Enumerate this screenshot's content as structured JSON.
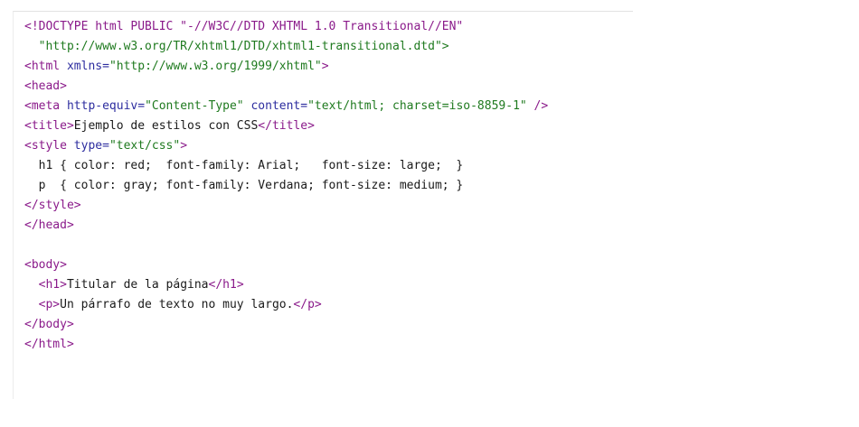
{
  "code_lines": [
    [
      {
        "t": "tag",
        "s": "<!DOCTYPE html PUBLIC \"-//W3C//DTD XHTML 1.0 Transitional//EN\""
      }
    ],
    [
      {
        "t": "val",
        "s": "  \"http://www.w3.org/TR/xhtml1/DTD/xhtml1-transitional.dtd\">"
      }
    ],
    [
      {
        "t": "tag",
        "s": "<html "
      },
      {
        "t": "attr",
        "s": "xmlns="
      },
      {
        "t": "val",
        "s": "\"http://www.w3.org/1999/xhtml\""
      },
      {
        "t": "tag",
        "s": ">"
      }
    ],
    [
      {
        "t": "tag",
        "s": "<head>"
      }
    ],
    [
      {
        "t": "tag",
        "s": "<meta "
      },
      {
        "t": "attr",
        "s": "http-equiv="
      },
      {
        "t": "val",
        "s": "\"Content-Type\""
      },
      {
        "t": "txt",
        "s": " "
      },
      {
        "t": "attr",
        "s": "content="
      },
      {
        "t": "val",
        "s": "\"text/html; charset=iso-8859-1\""
      },
      {
        "t": "tag",
        "s": " />"
      }
    ],
    [
      {
        "t": "tag",
        "s": "<title>"
      },
      {
        "t": "txt",
        "s": "Ejemplo de estilos con CSS"
      },
      {
        "t": "tag",
        "s": "</title>"
      }
    ],
    [
      {
        "t": "tag",
        "s": "<style "
      },
      {
        "t": "attr",
        "s": "type="
      },
      {
        "t": "val",
        "s": "\"text/css\""
      },
      {
        "t": "tag",
        "s": ">"
      }
    ],
    [
      {
        "t": "txt",
        "s": "  h1 { color: red;  font-family: Arial;   font-size: large;  }"
      }
    ],
    [
      {
        "t": "txt",
        "s": "  p  { color: gray; font-family: Verdana; font-size: medium; }"
      }
    ],
    [
      {
        "t": "tag",
        "s": "</style>"
      }
    ],
    [
      {
        "t": "tag",
        "s": "</head>"
      }
    ],
    [],
    [
      {
        "t": "tag",
        "s": "<body>"
      }
    ],
    [
      {
        "t": "tag",
        "s": "  <h1>"
      },
      {
        "t": "txt",
        "s": "Titular de la página"
      },
      {
        "t": "tag",
        "s": "</h1>"
      }
    ],
    [
      {
        "t": "tag",
        "s": "  <p>"
      },
      {
        "t": "txt",
        "s": "Un párrafo de texto no muy largo."
      },
      {
        "t": "tag",
        "s": "</p>"
      }
    ],
    [
      {
        "t": "tag",
        "s": "</body>"
      }
    ],
    [
      {
        "t": "tag",
        "s": "</html>"
      }
    ]
  ],
  "colors": {
    "tag": "#8a1a8a",
    "attribute": "#2d2d9f",
    "value": "#1f7a1f",
    "text": "#1a1a1a",
    "background": "#ffffff"
  }
}
